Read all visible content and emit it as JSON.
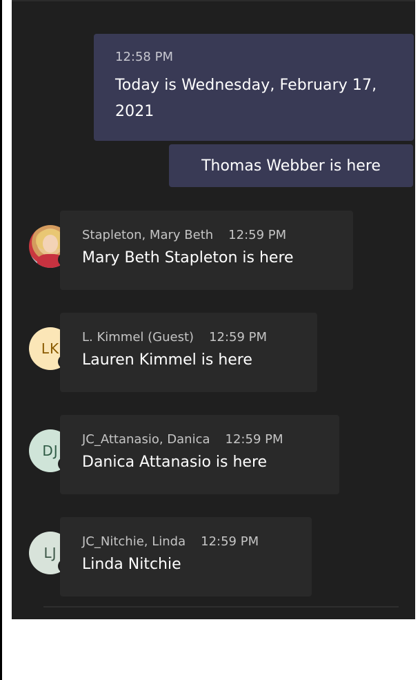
{
  "colors": {
    "panel_bg": "#1f1f1f",
    "own_bubble": "#393a55",
    "other_bubble": "#292929",
    "available": "#6bb700"
  },
  "system_message": {
    "time": "12:58 PM",
    "text": "Today is Wednesday, February 17, 2021"
  },
  "own_message": {
    "text": "Thomas Webber is here"
  },
  "messages": [
    {
      "sender": "Stapleton, Mary Beth",
      "time": "12:59 PM",
      "text": "Mary Beth Stapleton is here",
      "avatar_type": "photo",
      "presence": "available"
    },
    {
      "sender": "L. Kimmel (Guest)",
      "time": "12:59 PM",
      "text": "Lauren Kimmel is here",
      "initials": "LK",
      "avatar_bg": "#fbe6b7",
      "avatar_fg": "#8a5a00",
      "presence": "unknown"
    },
    {
      "sender": "JC_Attanasio, Danica",
      "time": "12:59 PM",
      "text": "Danica Attanasio is here",
      "initials": "DJ",
      "avatar_bg": "#cfe4d8",
      "avatar_fg": "#2f5b45",
      "presence": "offline"
    },
    {
      "sender": "JC_Nitchie, Linda",
      "time": "12:59 PM",
      "text": "Linda Nitchie",
      "initials": "LJ",
      "avatar_bg": "#d8e3da",
      "avatar_fg": "#3c5747",
      "presence": "offline"
    }
  ]
}
